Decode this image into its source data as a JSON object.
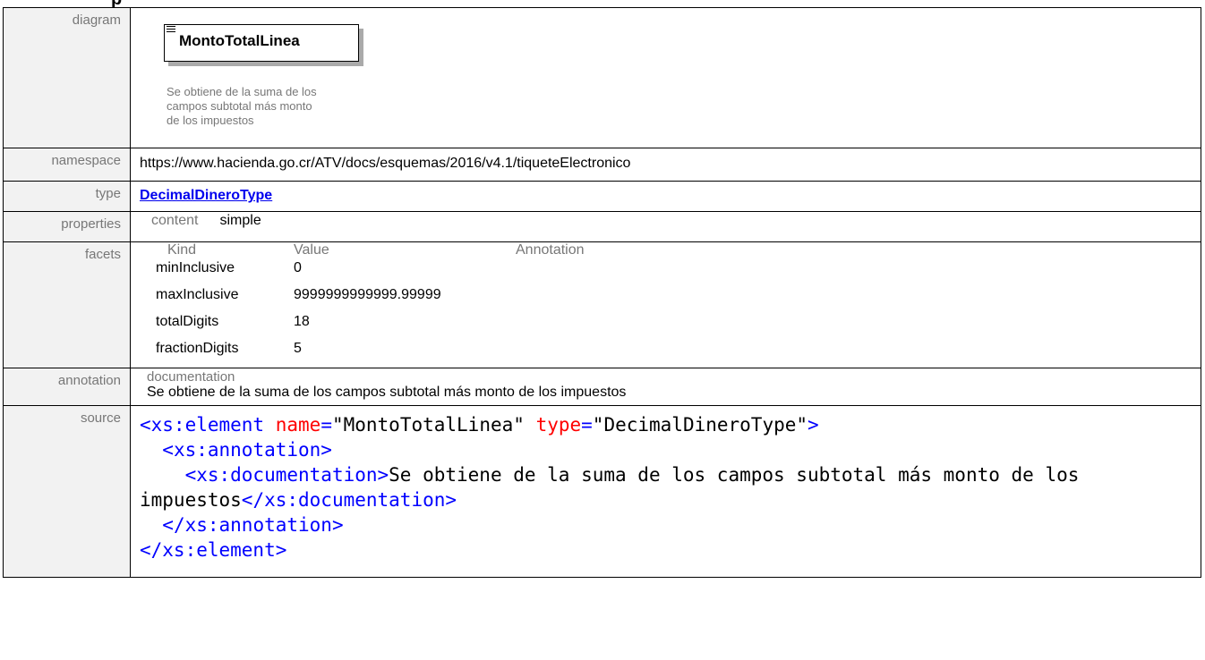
{
  "header_fragment": "p",
  "labels": {
    "diagram": "diagram",
    "namespace": "namespace",
    "type": "type",
    "properties": "properties",
    "facets": "facets",
    "annotation": "annotation",
    "source": "source"
  },
  "diagram": {
    "element_name": "MontoTotalLinea",
    "doc_lines": [
      "Se obtiene de la suma de los",
      "campos subtotal más monto",
      "de los impuestos"
    ]
  },
  "namespace": "https://www.hacienda.go.cr/ATV/docs/esquemas/2016/v4.1/tiqueteElectronico",
  "type": "DecimalDineroType",
  "properties": {
    "key": "content",
    "value": "simple"
  },
  "facets": {
    "headers": [
      "Kind",
      "Value",
      "Annotation"
    ],
    "rows": [
      {
        "kind": "minInclusive",
        "value": "0"
      },
      {
        "kind": "maxInclusive",
        "value": "9999999999999.99999"
      },
      {
        "kind": "totalDigits",
        "value": "18"
      },
      {
        "kind": "fractionDigits",
        "value": "5"
      }
    ]
  },
  "annotation": {
    "sub": "documentation",
    "text": "Se obtiene de la suma de los campos subtotal más monto de los impuestos"
  },
  "source": {
    "l1_open": "<xs:element",
    "l1_attr1": "name",
    "l1_eq1": "=",
    "l1_val1": "\"MontoTotalLinea\"",
    "l1_attr2": "type",
    "l1_eq2": "=",
    "l1_val2": "\"DecimalDineroType\"",
    "l1_close": ">",
    "l2": "<xs:annotation>",
    "l3_open": "<xs:documentation>",
    "l3_text": "Se obtiene de la suma de los campos subtotal más monto de los impuestos",
    "l3_close": "</xs:documentation>",
    "l4": "</xs:annotation>",
    "l5": "</xs:element>"
  }
}
